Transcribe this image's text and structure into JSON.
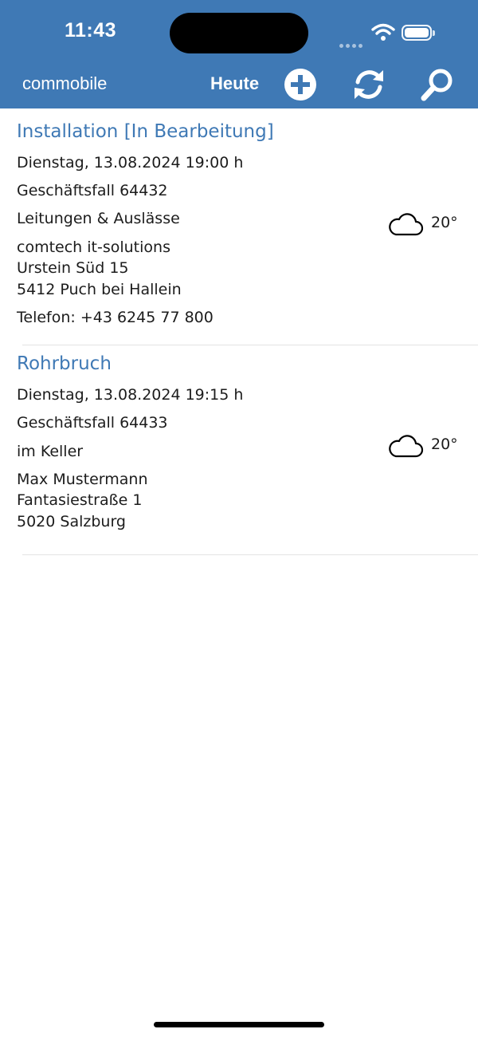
{
  "status_bar": {
    "time": "11:43"
  },
  "nav": {
    "app_title": "commobile",
    "today_label": "Heute",
    "add_icon": "plus-circle-icon",
    "refresh_icon": "refresh-icon",
    "search_icon": "search-icon"
  },
  "colors": {
    "header_bg": "#3f79b5",
    "accent": "#3f79b5"
  },
  "appointments": [
    {
      "title": "Installation [In Bearbeitung]",
      "datetime": "Dienstag, 13.08.2024  19:00 h",
      "case": "Geschäftsfall 64432",
      "description": "Leitungen & Auslässe",
      "customer": "comtech it-solutions",
      "street": "Urstein Süd 15",
      "city": "5412 Puch bei Hallein",
      "phone": "Telefon: +43 6245 77 800",
      "weather_icon": "cloud-icon",
      "temperature": "20°"
    },
    {
      "title": "Rohrbruch",
      "datetime": "Dienstag, 13.08.2024  19:15 h",
      "case": "Geschäftsfall 64433",
      "description": "im Keller",
      "customer": "Max Mustermann",
      "street": "Fantasiestraße 1",
      "city": "5020 Salzburg",
      "weather_icon": "cloud-icon",
      "temperature": "20°"
    }
  ]
}
